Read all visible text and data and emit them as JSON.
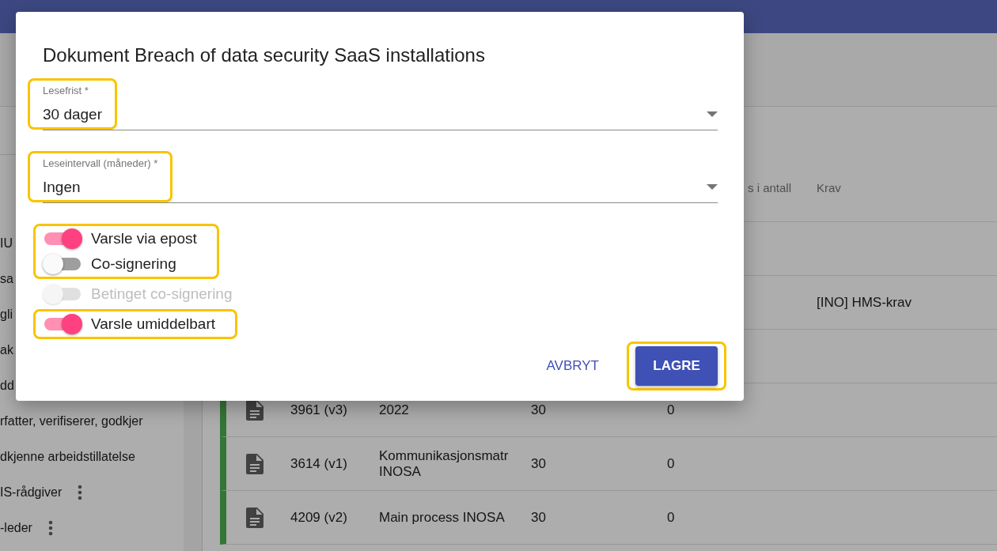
{
  "dialog": {
    "title": "Dokument Breach of data security SaaS installations",
    "fields": [
      {
        "label": "Lesefrist *",
        "value": "30 dager",
        "highlighted": true
      },
      {
        "label": "Leseintervall (måneder) *",
        "value": "Ingen",
        "highlighted": true
      }
    ],
    "toggles": [
      {
        "label": "Varsle via epost",
        "on": true,
        "disabled": false,
        "highlighted": true
      },
      {
        "label": "Co-signering",
        "on": false,
        "disabled": false,
        "highlighted": true
      },
      {
        "label": "Betinget co-signering",
        "on": false,
        "disabled": true,
        "highlighted": false
      },
      {
        "label": "Varsle umiddelbart",
        "on": true,
        "disabled": false,
        "highlighted": true
      }
    ],
    "buttons": [
      {
        "label": "AVBRYT",
        "kind": "text",
        "highlighted": false
      },
      {
        "label": "LAGRE",
        "kind": "primary",
        "highlighted": true
      }
    ]
  },
  "sidebar": {
    "items": [
      {
        "label": "IU"
      },
      {
        "label": "sa"
      },
      {
        "label": "gli"
      },
      {
        "label": "ak"
      },
      {
        "label": "dd"
      },
      {
        "label": "rfatter, verifiserer, godkjer",
        "has_menu": false
      },
      {
        "label": "dkjenne arbeidstillatelse",
        "has_menu": false
      },
      {
        "label": "IS-rådgiver",
        "has_menu": true
      },
      {
        "label": "-leder",
        "has_menu": true
      }
    ]
  },
  "table": {
    "columns": [
      {
        "label": "s i antall"
      },
      {
        "label": "Krav"
      }
    ],
    "rows": [
      {},
      {
        "krav": "[INO] HMS-krav"
      },
      {},
      {
        "kind": "document",
        "id": "3961 (v3)",
        "title": "2022",
        "column_4": "30",
        "column_5": "0"
      },
      {
        "kind": "document",
        "id": "3614 (v1)",
        "title": "Kommunikasjonsmatr INOSA",
        "column_4": "30",
        "column_5": "0"
      },
      {
        "kind": "document",
        "id": "4209 (v2)",
        "title": "Main process INOSA",
        "column_4": "30",
        "column_5": "0"
      }
    ]
  }
}
